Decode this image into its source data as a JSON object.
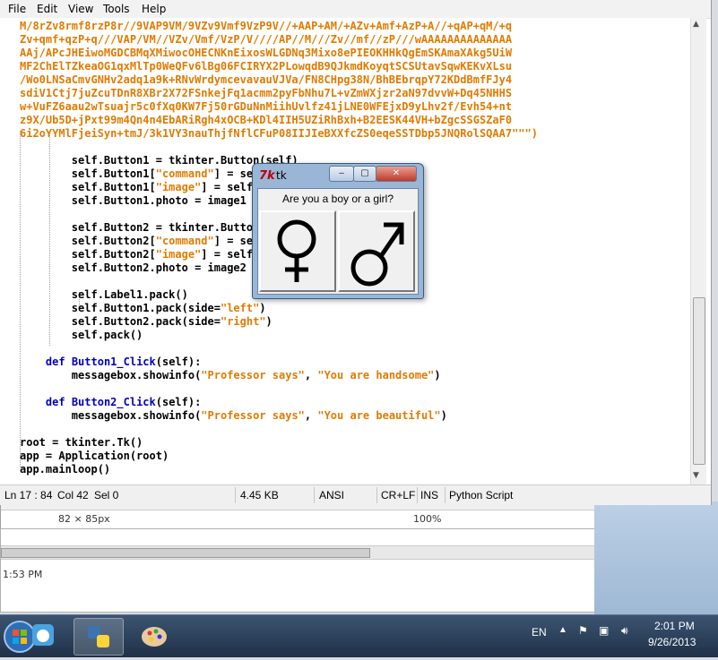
{
  "menu": [
    {
      "label": "File"
    },
    {
      "label": "Edit"
    },
    {
      "label": "View"
    },
    {
      "label": "Tools"
    },
    {
      "label": "Help"
    }
  ],
  "code_lines": [
    "M/8rZv8rmf8rzP8r//9VAP9VM/9VZv9Vmf9VzP9V//+AAP+AM/+AZv+Amf+AzP+A//+qAP+qM/+q",
    "Zv+qmf+qzP+q///VAP/VM//VZv/Vmf/VzP/V////AP//M///Zv//mf//zP///wAAAAAAAAAAAAAA",
    "AAj/APcJHEiwoMGDCBMqXMiwocOHECNKnEixosWLGDNq3Mixo8ePIEOKHHkQgEmSKAmaXAkg5UiW",
    "MF2ChElTZkeaOG1qxMlTp0WeQFv6lBg06FCIRYX2PLowqdB9QJkmdKoyqtSCSUtavSqwKEKvXLsu",
    "/Wo0LNSaCmvGNHv2adq1a9k+RNvWrdymcevavauVJVa/FN8CHpg38N/BhBEbrqpY72KDdBmfFJy4",
    "sdiV1Ctj7juZcuTDnR8XBr2X72FSnkejFq1acmm2pyFbNhu7L+vZmWXjzr2aN97dvvW+Dq45NHHS",
    "w+VuFZ6aau2wTsuajr5c0fXq0KW7Fj50rGDuNnMiihUvlfz41jLNE0WFEjxD9yLhv2f/Evh54+nt",
    "z9X/Ub5D+jPxt99m4Qn4n4EbARiRgh4xOCB+KDl4IIH5UZiRhBxh+B2EESK44VH+bZgcSSGSZaF0",
    "6i2oYYMlFjeiSyn+tmJ/3k1VY3nauThjfNflCFuP08IIJIeBXXfcZS0eqeSSTDbp5JNQRolSQAA7\"\"\")",
    "",
    "        self.Button1 = tkinter.Button(self)",
    "        self.Button1[\"command\"] = self.Button1_Click",
    "        self.Button1[\"image\"] = self.photo1",
    "        self.Button1.photo = image1",
    "",
    "        self.Button2 = tkinter.Button(self)",
    "        self.Button2[\"command\"] = self.Button2_Click",
    "        self.Button2[\"image\"] = self.photo2",
    "        self.Button2.photo = image2",
    "",
    "        self.Label1.pack()",
    "        self.Button1.pack(side=\"left\")",
    "        self.Button2.pack(side=\"right\")",
    "        self.pack()",
    "",
    "    def Button1_Click(self):",
    "        messagebox.showinfo(\"Professor says\", \"You are handsome\")",
    "",
    "    def Button2_Click(self):",
    "        messagebox.showinfo(\"Professor says\", \"You are beautiful\")",
    "",
    "root = tkinter.Tk()",
    "app = Application(root)",
    "app.mainloop()"
  ],
  "status": {
    "position": "Ln 17 : 84",
    "col": "Col 42",
    "sel": "Sel 0",
    "size": "4.45 KB",
    "encoding": "ANSI",
    "line_ending": "CR+LF",
    "mode": "INS",
    "language": "Python Script"
  },
  "tk_dialog": {
    "title": "tk",
    "label": "Are you a boy or a girl?",
    "button1_symbol": "female-symbol",
    "button2_symbol": "male-symbol",
    "min_label": "‒",
    "max_label": "▢",
    "close_label": "✕"
  },
  "background": {
    "dims_text": "82 × 85px",
    "zoom_text": "100%",
    "time_text": "1:53 PM"
  },
  "tray": {
    "language": "EN",
    "time": "2:01 PM",
    "date": "9/26/2013"
  },
  "colors": {
    "string": "#e07b00",
    "keyword": "#0000c0",
    "taskbar": "#2a4060"
  }
}
